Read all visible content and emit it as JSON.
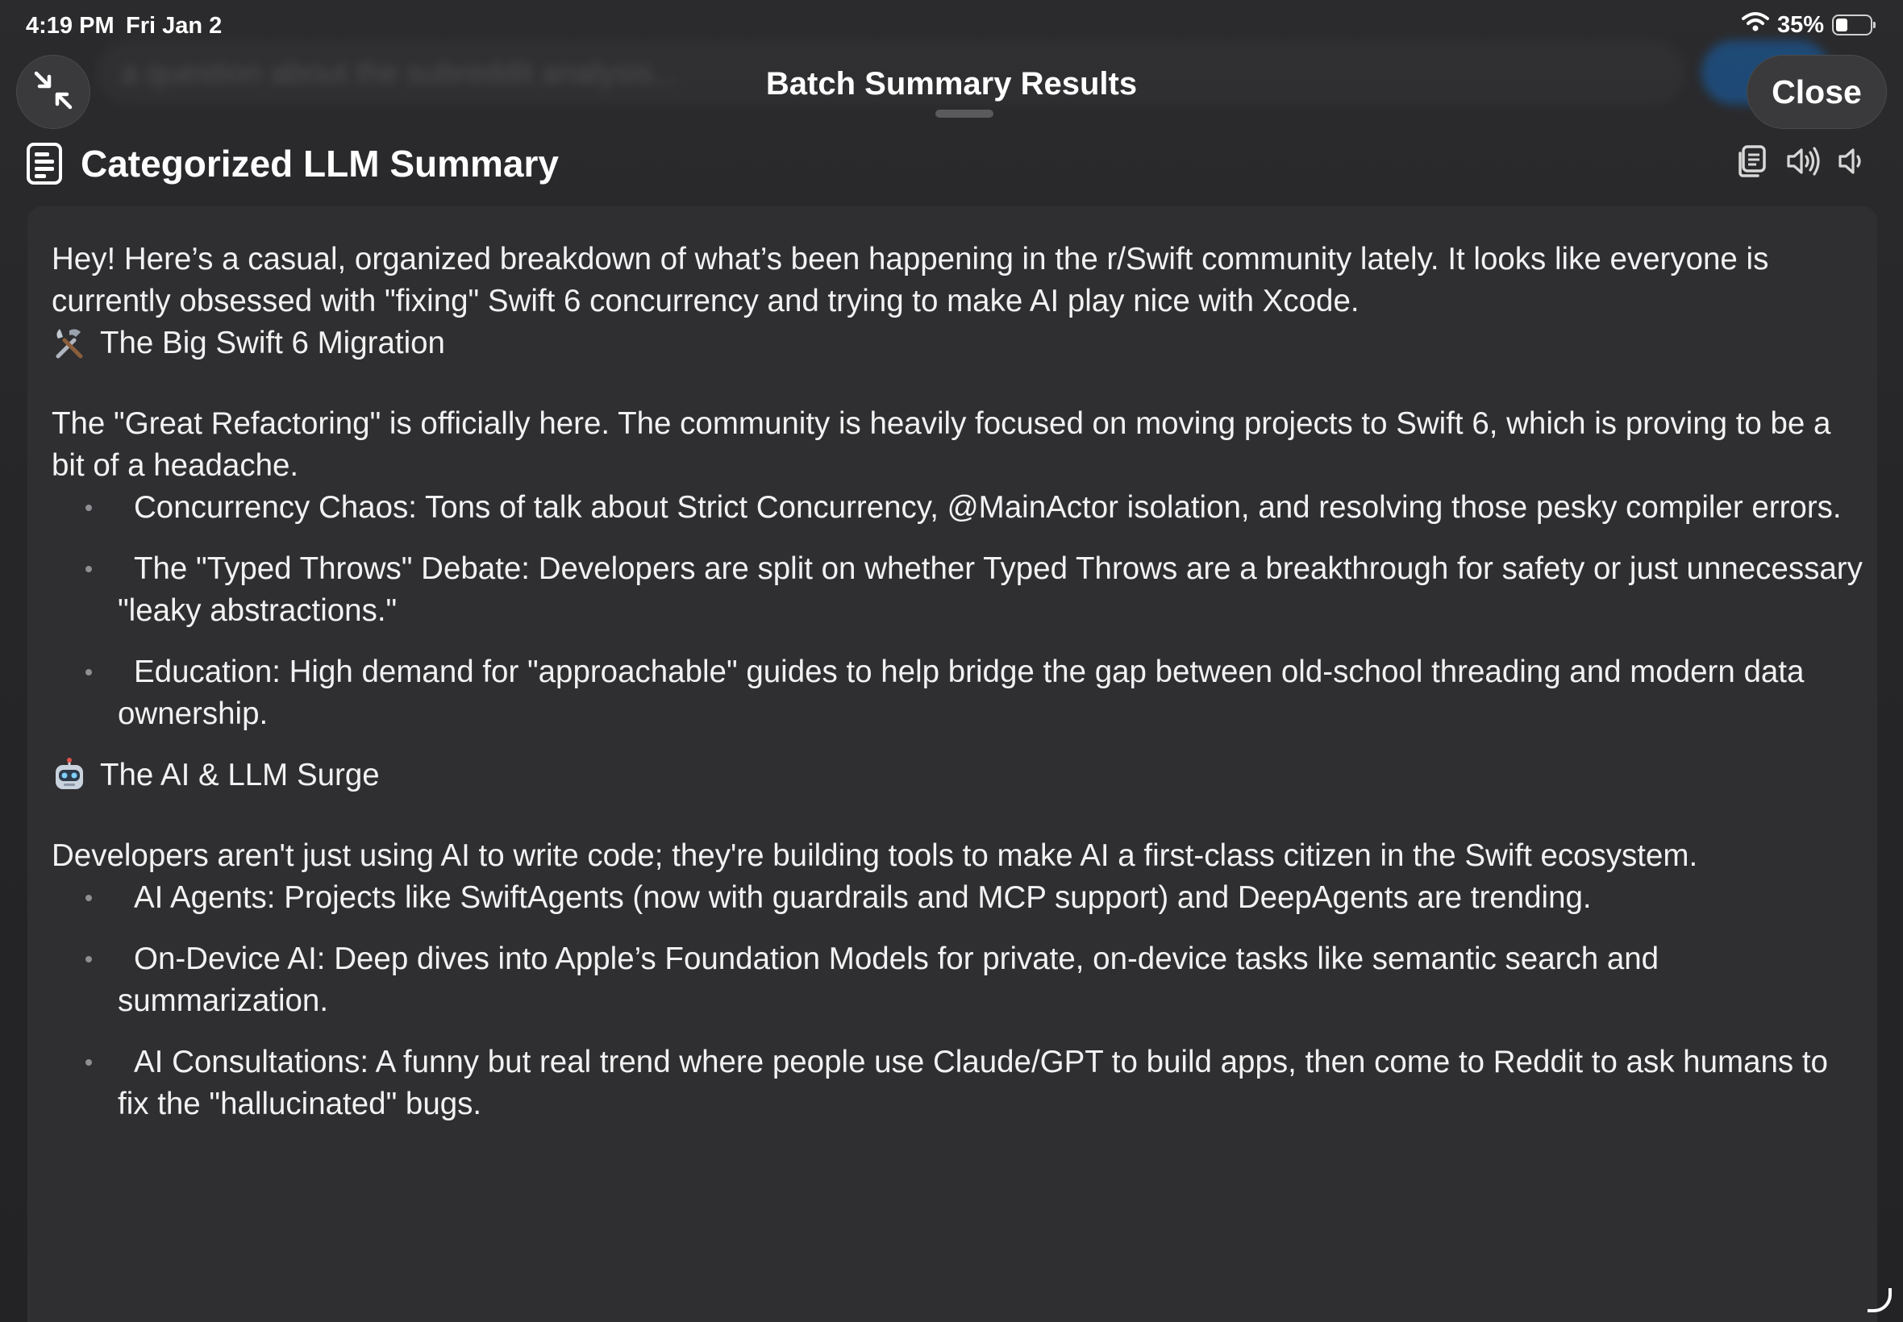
{
  "background_app": {
    "field_placeholder": "a question about the subreddit analysis..."
  },
  "status_bar": {
    "time": "4:19 PM",
    "date": "Fri Jan 2",
    "battery_percent": "35%",
    "battery_level": 0.35
  },
  "sheet": {
    "title": "Batch Summary Results",
    "close_label": "Close"
  },
  "section": {
    "title": "Categorized LLM Summary"
  },
  "summary": {
    "intro": "Hey! Here’s a casual, organized breakdown of what’s been happening in the r/Swift community lately. It looks like everyone is currently obsessed with \"fixing\" Swift 6 concurrency and trying to make AI play nice with Xcode.",
    "sections": [
      {
        "emoji": "🛠",
        "heading": "The Big Swift 6 Migration",
        "body": "The \"Great Refactoring\" is officially here. The community is heavily focused on moving projects to Swift 6, which is proving to be a bit of a headache.",
        "bullets": [
          "Concurrency Chaos: Tons of talk about Strict Concurrency, @MainActor isolation, and resolving those pesky compiler errors.",
          "The \"Typed Throws\" Debate: Developers are split on whether Typed Throws are a breakthrough for safety or just unnecessary \"leaky abstractions.\"",
          "Education: High demand for \"approachable\" guides to help bridge the gap between old-school threading and modern data ownership."
        ]
      },
      {
        "emoji": "🤖",
        "heading": "The AI & LLM Surge",
        "body": "Developers aren't just using AI to write code; they're building tools to make AI a first-class citizen in the Swift ecosystem.",
        "bullets": [
          "AI Agents: Projects like SwiftAgents (now with guardrails and MCP support) and DeepAgents are trending.",
          "On-Device AI: Deep dives into Apple’s Foundation Models for private, on-device tasks like semantic search and summarization.",
          "AI Consultations: A funny but real trend where people use Claude/GPT to build apps, then come to Reddit to ask humans to fix the \"hallucinated\" bugs."
        ]
      }
    ]
  },
  "icons": {
    "collapse": "arrows-collapse-icon",
    "document": "document-icon",
    "copy": "copy-icon",
    "speak_all": "speaker-wave-icon",
    "speak": "speaker-icon",
    "wifi": "wifi-icon",
    "battery": "battery-icon"
  }
}
